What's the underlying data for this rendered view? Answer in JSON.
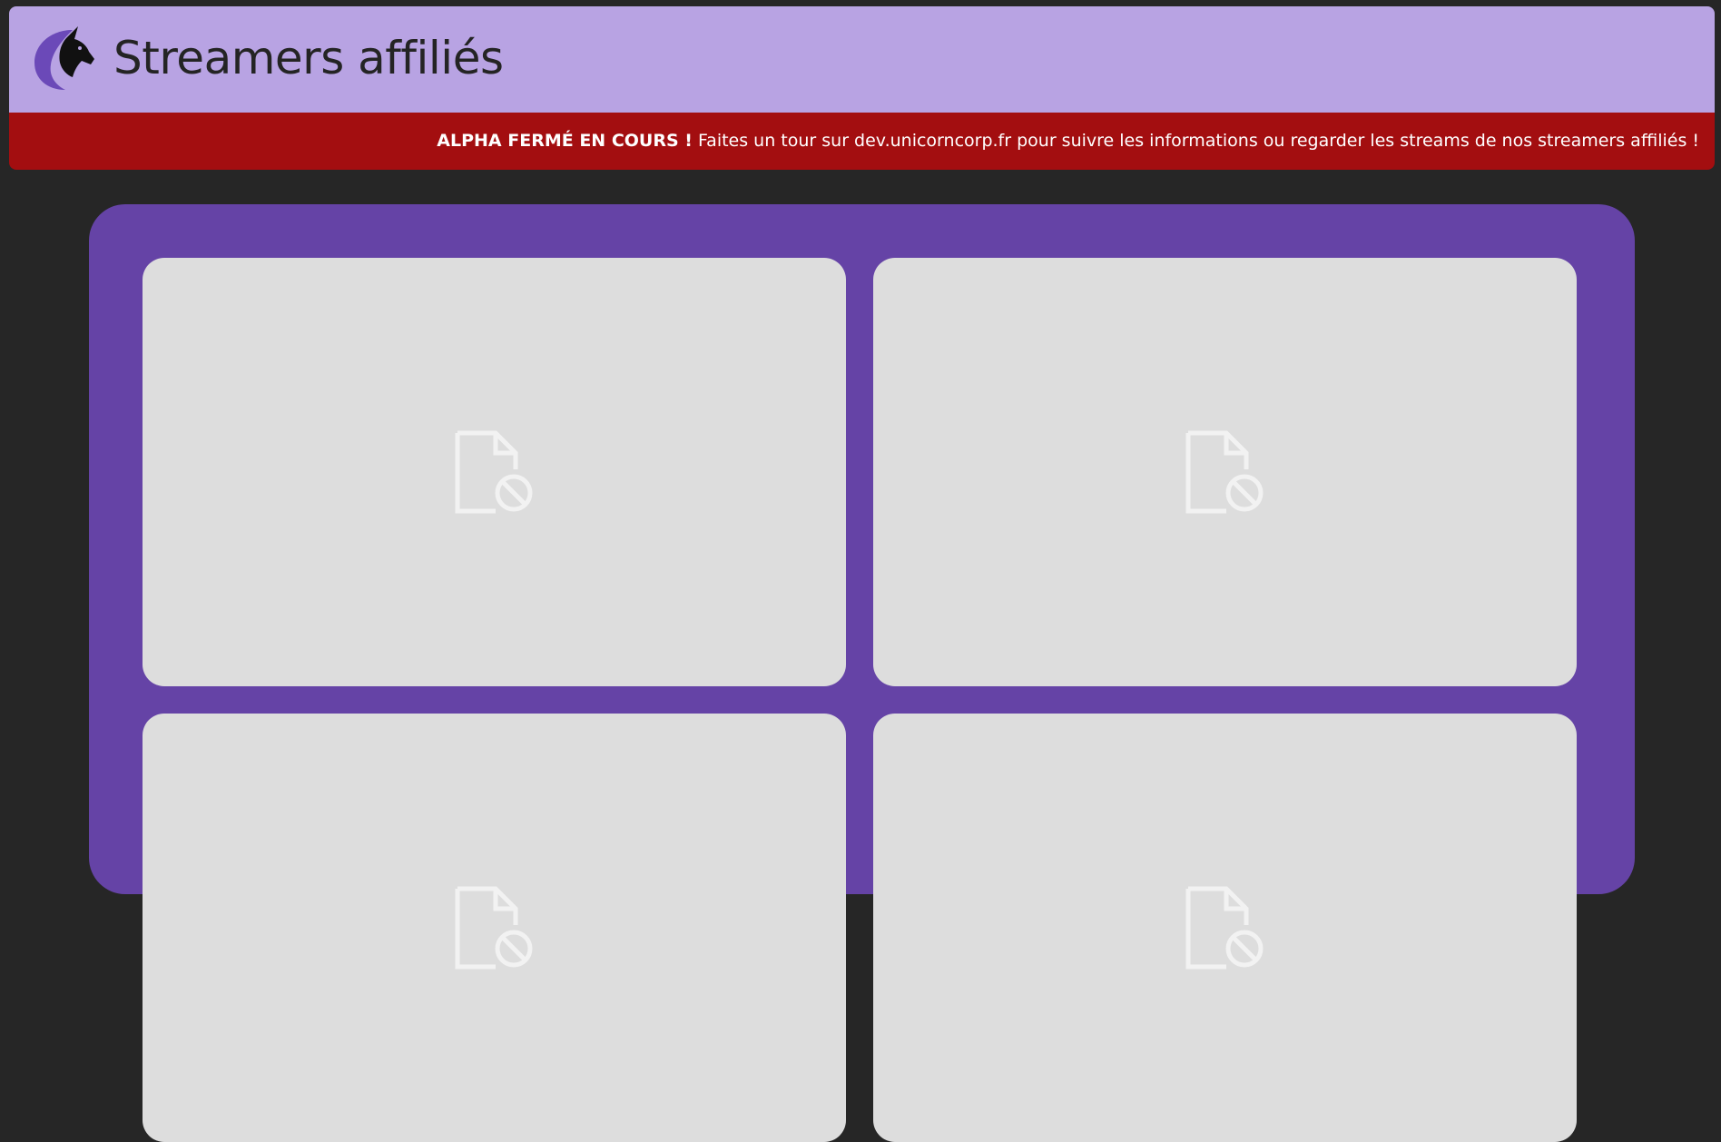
{
  "header": {
    "title": "Streamers affiliés",
    "logo_icon": "unicorn-logo-icon"
  },
  "banner": {
    "strong": "ALPHA FERMÉ EN COURS !",
    "text": " Faites un tour sur dev.unicorncorp.fr pour suivre les informations ou regarder les streams de nos streamers affiliés !",
    "color": "#a30e10"
  },
  "theme": {
    "header_bg": "#b8a3e3",
    "panel_bg": "#6543a6",
    "card_bg": "#dddddd",
    "page_bg": "#262626"
  },
  "cards": [
    {
      "icon": "broken-file-icon"
    },
    {
      "icon": "broken-file-icon"
    },
    {
      "icon": "broken-file-icon"
    },
    {
      "icon": "broken-file-icon"
    }
  ]
}
